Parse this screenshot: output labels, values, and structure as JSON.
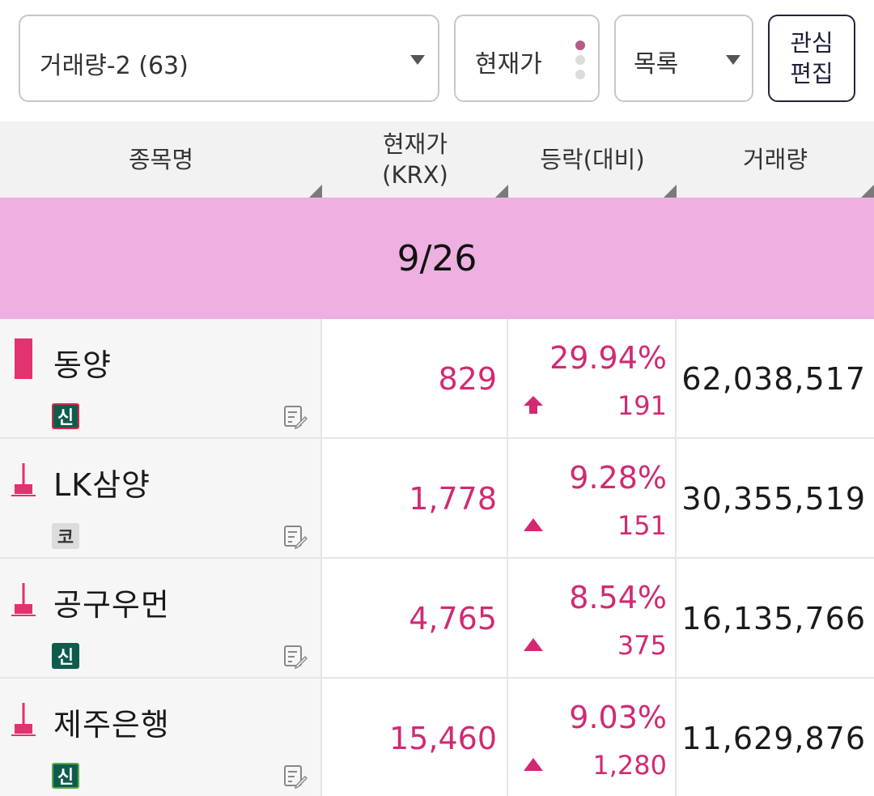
{
  "toolbar": {
    "group_select": "거래량-2 (63)",
    "price_select": "현재가",
    "view_select": "목록",
    "edit_button": "관심\n편집"
  },
  "table": {
    "headers": {
      "name": "종목명",
      "price": "현재가\n(KRX)",
      "change": "등락(대비)",
      "volume": "거래량"
    },
    "date_banner": "9/26",
    "rows": [
      {
        "name": "동양",
        "badge": "신",
        "badge_style": "new-red",
        "price": "829",
        "change_pct": "29.94%",
        "change_amt": "191",
        "direction": "upper-limit",
        "volume": "62,038,517"
      },
      {
        "name": "LK삼양",
        "badge": "코",
        "badge_style": "kosdaq",
        "price": "1,778",
        "change_pct": "9.28%",
        "change_amt": "151",
        "direction": "up",
        "volume": "30,355,519"
      },
      {
        "name": "공구우먼",
        "badge": "신",
        "badge_style": "new",
        "price": "4,765",
        "change_pct": "8.54%",
        "change_amt": "375",
        "direction": "up",
        "volume": "16,135,766"
      },
      {
        "name": "제주은행",
        "badge": "신",
        "badge_style": "new-green",
        "price": "15,460",
        "change_pct": "9.03%",
        "change_amt": "1,280",
        "direction": "up",
        "volume": "11,629,876"
      }
    ]
  },
  "colors": {
    "up": "#d12a73",
    "banner_bg": "#edb0e0",
    "badge_new": "#0f5c4e",
    "badge_kosdaq": "#d9d9d9"
  },
  "icons": {
    "memo": "memo-edit-icon",
    "candle": "candlestick-icon",
    "up_arrow": "up-arrow-icon",
    "upper_limit": "upper-limit-arrow-icon"
  }
}
